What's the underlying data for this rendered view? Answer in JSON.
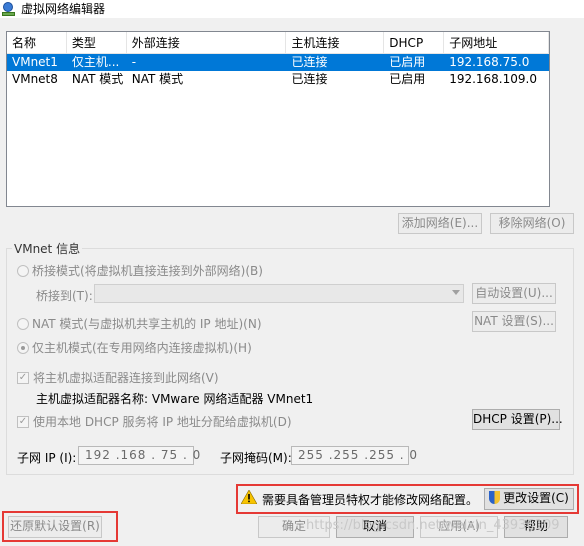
{
  "window": {
    "title": "虚拟网络编辑器"
  },
  "table": {
    "headers": [
      "名称",
      "类型",
      "外部连接",
      "主机连接",
      "DHCP",
      "子网地址"
    ],
    "rows": [
      [
        "VMnet1",
        "仅主机...",
        "-",
        "已连接",
        "已启用",
        "192.168.75.0"
      ],
      [
        "VMnet8",
        "NAT 模式",
        "NAT 模式",
        "已连接",
        "已启用",
        "192.168.109.0"
      ]
    ],
    "selected_row": 0
  },
  "buttons": {
    "add_network": "添加网络(E)...",
    "remove_network": "移除网络(O)",
    "auto_settings": "自动设置(U)...",
    "nat_settings": "NAT 设置(S)...",
    "dhcp_settings": "DHCP 设置(P)...",
    "change_settings": "更改设置(C)",
    "restore_defaults": "还原默认设置(R)",
    "ok": "确定",
    "cancel": "取消",
    "apply": "应用(A)",
    "help": "帮助"
  },
  "vmnet_info": {
    "group_label": "VMnet 信息",
    "bridged_mode": "桥接模式(将虚拟机直接连接到外部网络)(B)",
    "bridged_to_label": "桥接到(T):",
    "bridged_to_value": "",
    "nat_mode": "NAT 模式(与虚拟机共享主机的 IP 地址)(N)",
    "host_only_mode": "仅主机模式(在专用网络内连接虚拟机)(H)",
    "connect_adapter": "将主机虚拟适配器连接到此网络(V)",
    "adapter_name": "主机虚拟适配器名称: VMware 网络适配器 VMnet1",
    "use_dhcp": "使用本地 DHCP 服务将 IP 地址分配给虚拟机(D)",
    "subnet_ip_label": "子网 IP (I):",
    "subnet_ip_value": "192 .168 . 75  .  0",
    "subnet_mask_label": "子网掩码(M):",
    "subnet_mask_value": "255 .255 .255 .  0",
    "selected_mode": "host-only",
    "connect_adapter_checked": true,
    "use_dhcp_checked": true
  },
  "warning": {
    "text": "需要具备管理员特权才能修改网络配置。"
  },
  "watermark": "https://blog.csdn.net/weixin_43936109",
  "colors": {
    "selection": "#0078d7",
    "highlight_box": "#e53935"
  }
}
